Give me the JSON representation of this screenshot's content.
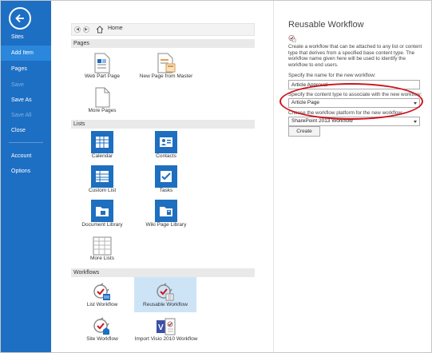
{
  "sidebar": {
    "items": [
      {
        "label": "Sites"
      },
      {
        "label": "Add Item"
      },
      {
        "label": "Pages"
      },
      {
        "label": "Save"
      },
      {
        "label": "Save As"
      },
      {
        "label": "Save All"
      },
      {
        "label": "Close"
      },
      {
        "label": "Account"
      },
      {
        "label": "Options"
      }
    ]
  },
  "breadcrumb": {
    "label": "Home"
  },
  "sections": {
    "pages": "Pages",
    "lists": "Lists",
    "workflows": "Workflows"
  },
  "pages_tiles": [
    "Web Part Page",
    "New Page from Master",
    "More Pages"
  ],
  "lists_tiles": [
    "Calendar",
    "Contacts",
    "Custom List",
    "Tasks",
    "Document Library",
    "Wiki Page Library",
    "More Lists"
  ],
  "workflow_tiles": [
    "List Workflow",
    "Reusable Workflow",
    "Site Workflow",
    "Import Visio 2010 Workflow"
  ],
  "panel": {
    "title": "Reusable Workflow",
    "description": "Create a workflow that can be attached to any list or content type that derives from a specified base content type.  The workflow name given here will be used to identify the workflow to end users.",
    "name_label": "Specify the name for the new workflow:",
    "name_value": "Article Approval",
    "content_type_label": "Specify the content type to associate with the new workflow:",
    "content_type_value": "Article Page",
    "platform_label": "Choose the workflow platform for the new workflow:",
    "platform_value": "SharePoint 2013 Workflow",
    "create_label": "Create"
  },
  "colors": {
    "sidebar": "#1d6fc4",
    "accent": "#1e6fbf",
    "highlight": "#d0121b"
  }
}
